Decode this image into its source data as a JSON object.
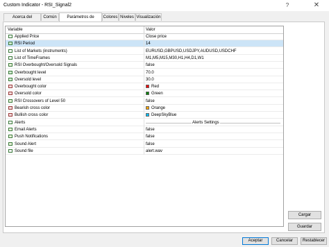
{
  "window": {
    "title": "Custom Indicator - RSI_Signal2",
    "help_glyph": "?",
    "close_glyph": "✕"
  },
  "tabs": [
    {
      "label": "Acerca del programa"
    },
    {
      "label": "Común"
    },
    {
      "label": "Parámetros de entrada",
      "active": true
    },
    {
      "label": "Colores"
    },
    {
      "label": "Niveles"
    },
    {
      "label": "Visualización"
    }
  ],
  "grid": {
    "headers": {
      "variable": "Variable",
      "value": "Valor"
    },
    "rows": [
      {
        "type": "str",
        "variable": "Applied Price",
        "value": "Close price"
      },
      {
        "type": "int",
        "variable": "RSI Period",
        "value": "14",
        "selected": true
      },
      {
        "type": "str",
        "variable": "List of Markets (instruments)",
        "value": "EURUSD,GBPUSD,USDJPY,AUDUSD,USDCHF"
      },
      {
        "type": "str",
        "variable": "List of TimeFrames",
        "value": "M1,M5,M15,M30,H1,H4,D1,W1"
      },
      {
        "type": "bool",
        "variable": "RSI Overbought/Oversold Signals",
        "value": "false"
      },
      {
        "type": "dbl",
        "variable": "Overbought level",
        "value": "70.0"
      },
      {
        "type": "dbl",
        "variable": "Oversold level",
        "value": "30.0"
      },
      {
        "type": "col",
        "variable": "Overbought color",
        "value": "Red",
        "swatch": "#ff0000"
      },
      {
        "type": "col",
        "variable": "Oversold color",
        "value": "Green",
        "swatch": "#008000"
      },
      {
        "type": "bool",
        "variable": "RSI Crossovers of Level 50",
        "value": "false"
      },
      {
        "type": "col",
        "variable": "Bearish cross color",
        "value": "Orange",
        "swatch": "#ffa500"
      },
      {
        "type": "col",
        "variable": "Bullish cross color",
        "value": "DeepSkyBlue",
        "swatch": "#00bfff"
      },
      {
        "type": "str",
        "variable": "Alerts",
        "group": "Alerts Settings"
      },
      {
        "type": "bool",
        "variable": "Email Alerts",
        "value": "false"
      },
      {
        "type": "bool",
        "variable": "Push Notifications",
        "value": "false"
      },
      {
        "type": "bool",
        "variable": "Sound Alert",
        "value": "false"
      },
      {
        "type": "str",
        "variable": "Sound file",
        "value": "alert.wav"
      }
    ]
  },
  "side_buttons": {
    "load": "Cargar",
    "save": "Guardar"
  },
  "footer_buttons": {
    "ok": "Aceptar",
    "cancel": "Cancelar",
    "reset": "Restablecer"
  }
}
